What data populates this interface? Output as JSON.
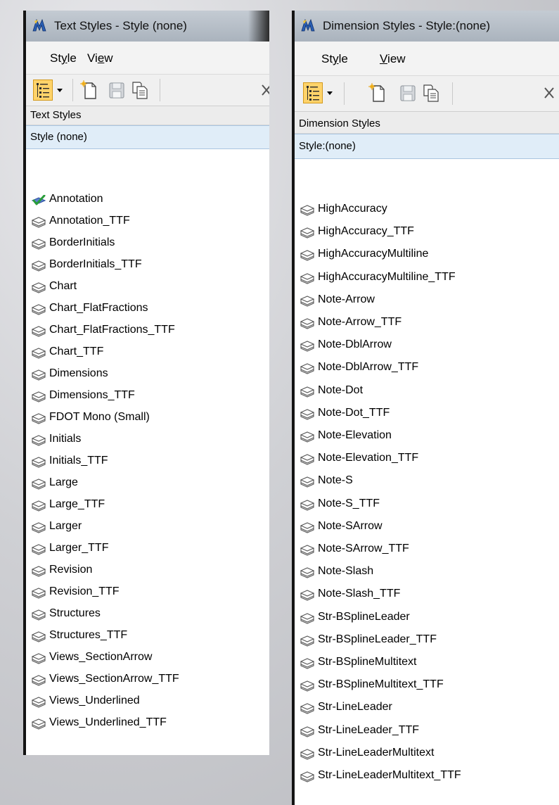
{
  "colors": {
    "accent": "#ffd36a",
    "selection": "#e0edf8",
    "check": "#2a9d3a"
  },
  "left": {
    "title": "Text Styles - Style (none)",
    "menu": [
      {
        "prefix": "St",
        "underline": "y",
        "suffix": "le"
      },
      {
        "prefix": "Vi",
        "underline": "e",
        "suffix": "w"
      }
    ],
    "section_label": "Text Styles",
    "current_style": "Style (none)",
    "items": [
      {
        "label": "Annotation",
        "icon": "active-check-icon"
      },
      {
        "label": "Annotation_TTF",
        "icon": "style-icon"
      },
      {
        "label": "BorderInitials",
        "icon": "style-icon"
      },
      {
        "label": "BorderInitials_TTF",
        "icon": "style-icon"
      },
      {
        "label": "Chart",
        "icon": "style-icon"
      },
      {
        "label": "Chart_FlatFractions",
        "icon": "style-icon"
      },
      {
        "label": "Chart_FlatFractions_TTF",
        "icon": "style-icon"
      },
      {
        "label": "Chart_TTF",
        "icon": "style-icon"
      },
      {
        "label": "Dimensions",
        "icon": "style-icon"
      },
      {
        "label": "Dimensions_TTF",
        "icon": "style-icon"
      },
      {
        "label": "FDOT Mono (Small)",
        "icon": "style-icon"
      },
      {
        "label": "Initials",
        "icon": "style-icon"
      },
      {
        "label": "Initials_TTF",
        "icon": "style-icon"
      },
      {
        "label": "Large",
        "icon": "style-icon"
      },
      {
        "label": "Large_TTF",
        "icon": "style-icon"
      },
      {
        "label": "Larger",
        "icon": "style-icon"
      },
      {
        "label": "Larger_TTF",
        "icon": "style-icon"
      },
      {
        "label": "Revision",
        "icon": "style-icon"
      },
      {
        "label": "Revision_TTF",
        "icon": "style-icon"
      },
      {
        "label": "Structures",
        "icon": "style-icon"
      },
      {
        "label": "Structures_TTF",
        "icon": "style-icon"
      },
      {
        "label": "Views_SectionArrow",
        "icon": "style-icon"
      },
      {
        "label": "Views_SectionArrow_TTF",
        "icon": "style-icon"
      },
      {
        "label": "Views_Underlined",
        "icon": "style-icon"
      },
      {
        "label": "Views_Underlined_TTF",
        "icon": "style-icon"
      }
    ]
  },
  "right": {
    "title": "Dimension Styles -  Style:(none)",
    "menu": [
      {
        "prefix": "St",
        "underline": "y",
        "suffix": "le"
      },
      {
        "prefix": "",
        "underline": "V",
        "suffix": "iew"
      }
    ],
    "section_label": "Dimension Styles",
    "current_style": "Style:(none)",
    "items": [
      {
        "label": "HighAccuracy",
        "icon": "style-icon"
      },
      {
        "label": "HighAccuracy_TTF",
        "icon": "style-icon"
      },
      {
        "label": "HighAccuracyMultiline",
        "icon": "style-icon"
      },
      {
        "label": "HighAccuracyMultiline_TTF",
        "icon": "style-icon"
      },
      {
        "label": "Note-Arrow",
        "icon": "style-icon"
      },
      {
        "label": "Note-Arrow_TTF",
        "icon": "style-icon"
      },
      {
        "label": "Note-DblArrow",
        "icon": "style-icon"
      },
      {
        "label": "Note-DblArrow_TTF",
        "icon": "style-icon"
      },
      {
        "label": "Note-Dot",
        "icon": "style-icon"
      },
      {
        "label": "Note-Dot_TTF",
        "icon": "style-icon"
      },
      {
        "label": "Note-Elevation",
        "icon": "style-icon"
      },
      {
        "label": "Note-Elevation_TTF",
        "icon": "style-icon"
      },
      {
        "label": "Note-S",
        "icon": "style-icon"
      },
      {
        "label": "Note-S_TTF",
        "icon": "style-icon"
      },
      {
        "label": "Note-SArrow",
        "icon": "style-icon"
      },
      {
        "label": "Note-SArrow_TTF",
        "icon": "style-icon"
      },
      {
        "label": "Note-Slash",
        "icon": "style-icon"
      },
      {
        "label": "Note-Slash_TTF",
        "icon": "style-icon"
      },
      {
        "label": "Str-BSplineLeader",
        "icon": "style-icon"
      },
      {
        "label": "Str-BSplineLeader_TTF",
        "icon": "style-icon"
      },
      {
        "label": "Str-BSplineMultitext",
        "icon": "style-icon"
      },
      {
        "label": "Str-BSplineMultitext_TTF",
        "icon": "style-icon"
      },
      {
        "label": "Str-LineLeader",
        "icon": "style-icon"
      },
      {
        "label": "Str-LineLeader_TTF",
        "icon": "style-icon"
      },
      {
        "label": "Str-LineLeaderMultitext",
        "icon": "style-icon"
      },
      {
        "label": "Str-LineLeaderMultitext_TTF",
        "icon": "style-icon"
      }
    ]
  }
}
